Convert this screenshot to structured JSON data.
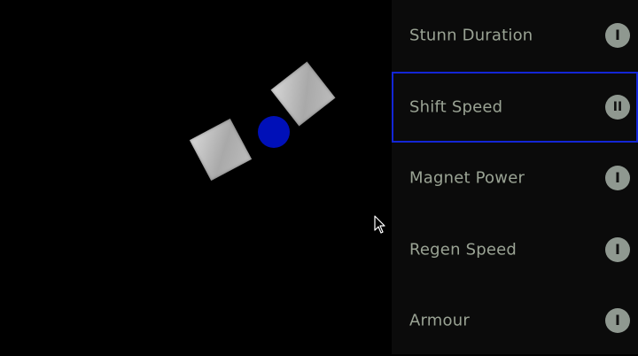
{
  "game": {
    "ship_color": "#0010b8",
    "plate_color": "#c4c4c4"
  },
  "upgrades": {
    "selected_index": 1,
    "selection_color": "#1326d6",
    "items": [
      {
        "label": "Stunn Duration",
        "level": "I"
      },
      {
        "label": "Shift Speed",
        "level": "II"
      },
      {
        "label": "Magnet Power",
        "level": "I"
      },
      {
        "label": "Regen Speed",
        "level": "I"
      },
      {
        "label": "Armour",
        "level": "I"
      }
    ]
  }
}
